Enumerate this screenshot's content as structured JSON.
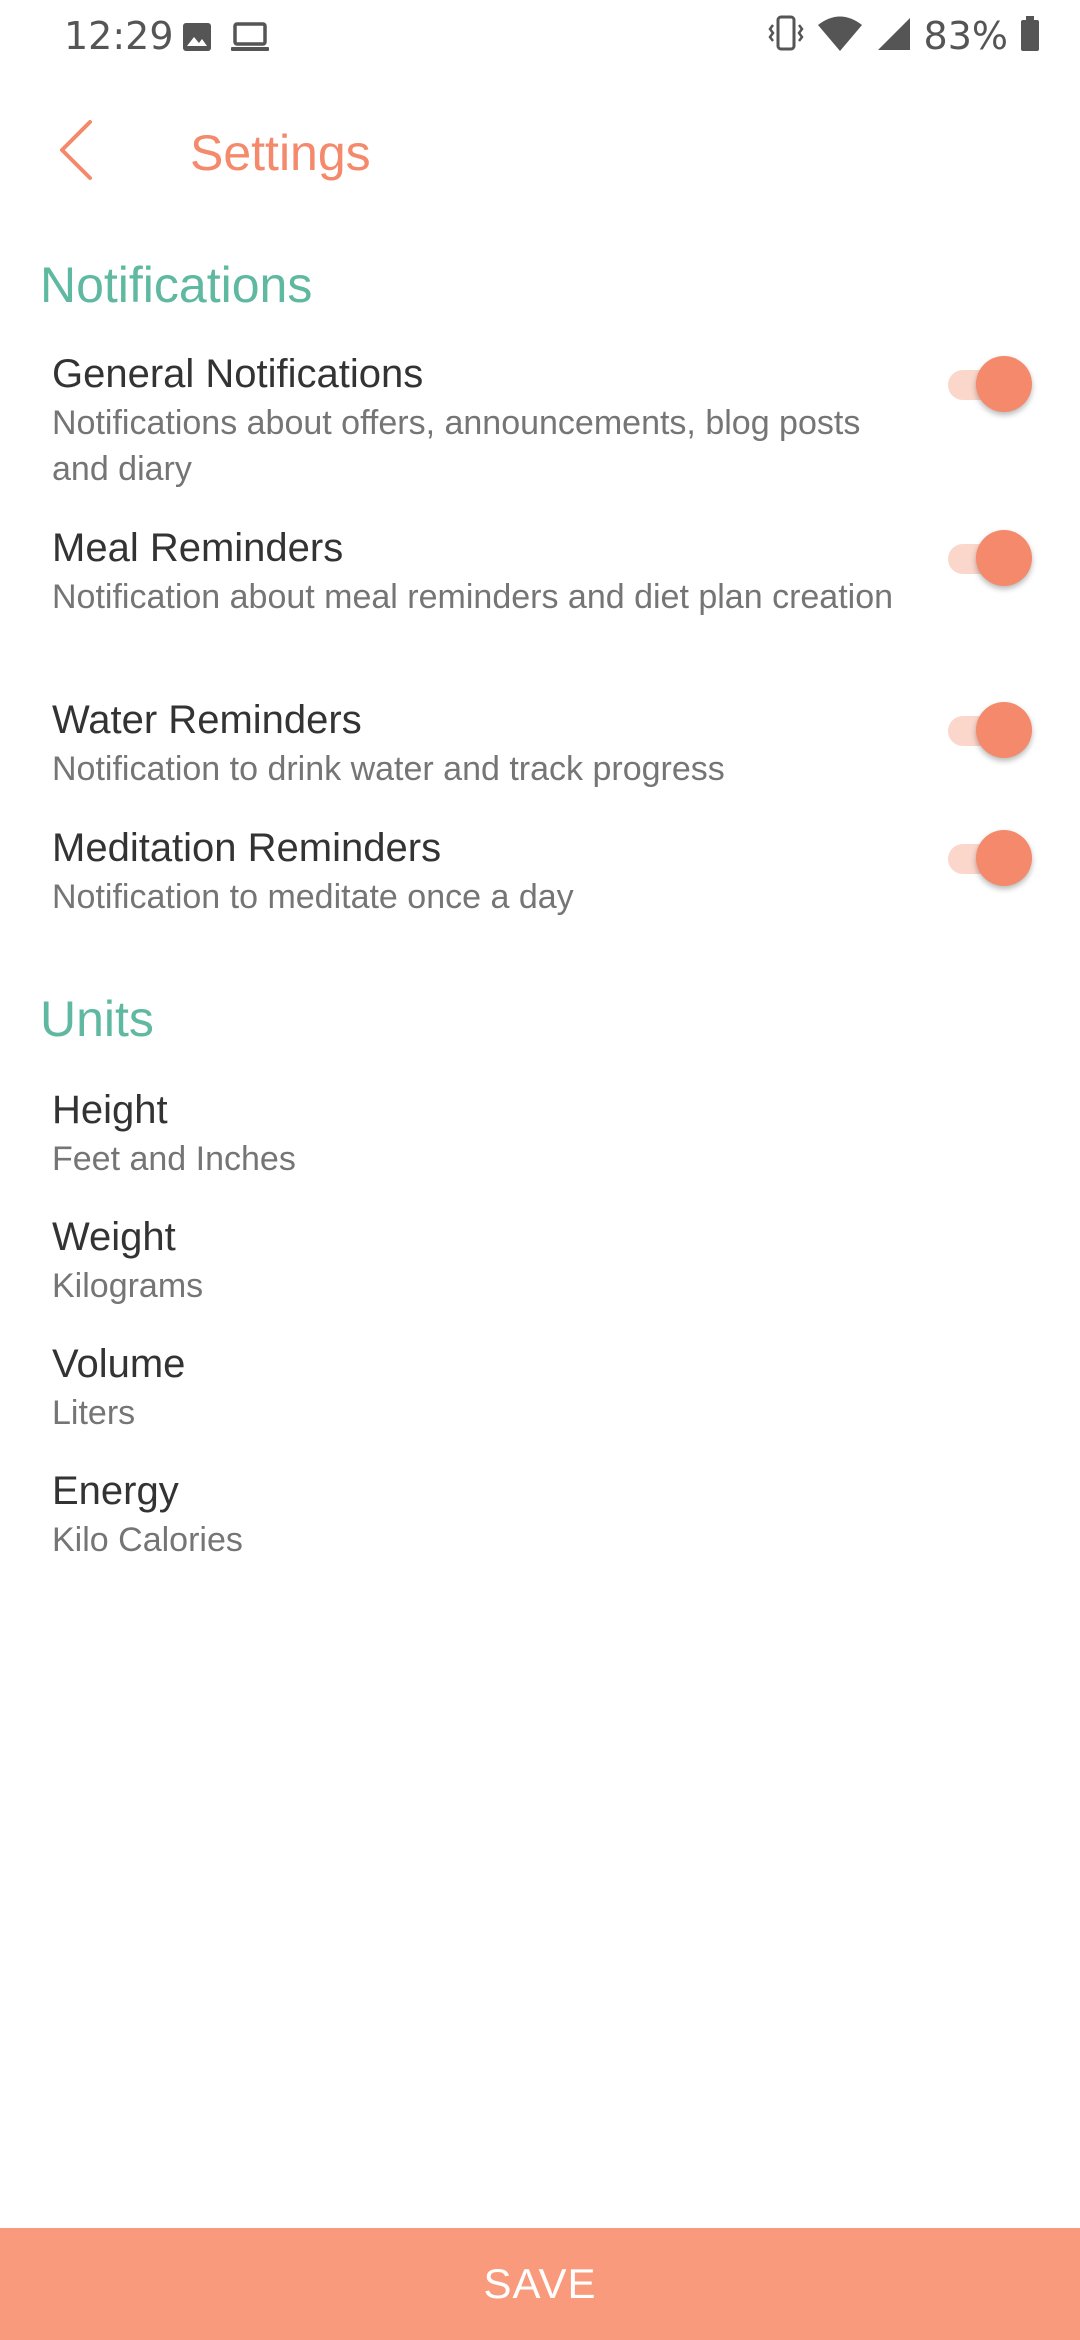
{
  "status_bar": {
    "time": "12:29",
    "battery": "83%",
    "icons": [
      "image-icon",
      "laptop-icon",
      "vibrate-icon",
      "wifi-icon",
      "signal-icon",
      "battery-icon"
    ]
  },
  "header": {
    "title": "Settings",
    "back_icon": "chevron-left-icon"
  },
  "sections": {
    "notifications": {
      "title": "Notifications",
      "items": [
        {
          "title": "General Notifications",
          "subtitle": "Notifications about offers, announcements, blog posts and diary",
          "enabled": true
        },
        {
          "title": "Meal Reminders",
          "subtitle": "Notification about meal reminders and diet plan creation",
          "enabled": true
        },
        {
          "title": "Water Reminders",
          "subtitle": "Notification to drink water and track progress",
          "enabled": true
        },
        {
          "title": "Meditation Reminders",
          "subtitle": "Notification to meditate once a day",
          "enabled": true
        }
      ]
    },
    "units": {
      "title": "Units",
      "items": [
        {
          "title": "Height",
          "value": "Feet and Inches"
        },
        {
          "title": "Weight",
          "value": "Kilograms"
        },
        {
          "title": "Volume",
          "value": "Liters"
        },
        {
          "title": "Energy",
          "value": "Kilo Calories"
        }
      ]
    }
  },
  "footer": {
    "save_label": "SAVE"
  },
  "colors": {
    "accent": "#f4896b",
    "section": "#5fb8a0",
    "save_bar": "#f99a7c"
  }
}
